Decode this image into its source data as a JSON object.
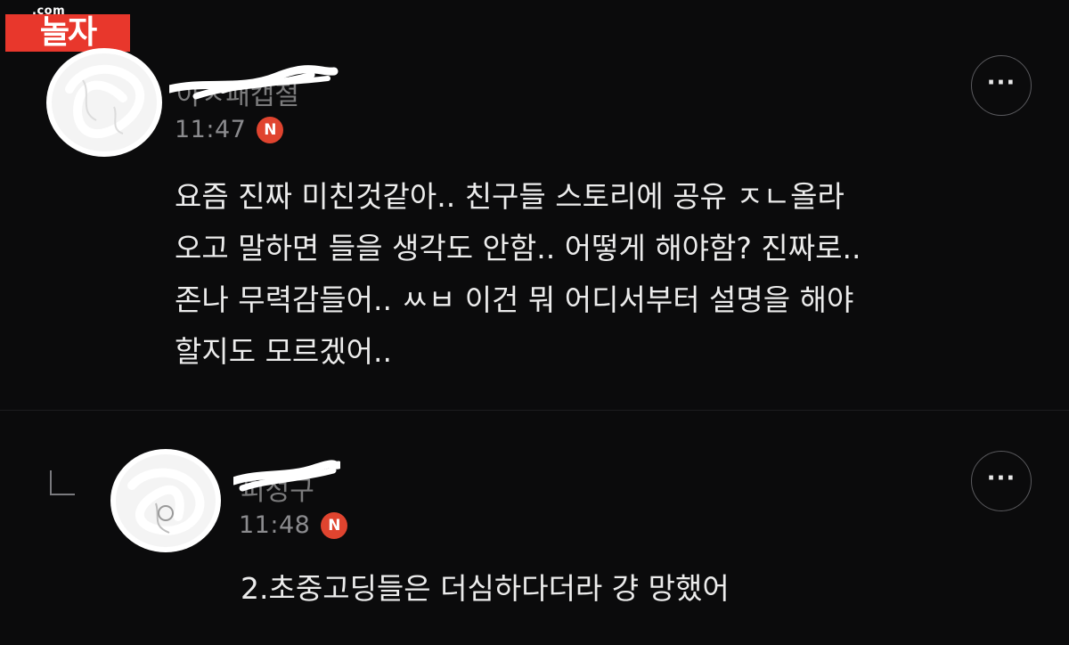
{
  "watermark": {
    "sub": ".com",
    "main": "놀자"
  },
  "comments": [
    {
      "author": "아ㅈ패캡철",
      "time": "11:47",
      "badge": "N",
      "more_label": "···",
      "lines": [
        "요즘 진짜 미친것같아.. 친구들 스토리에 공유 ㅈㄴ올라",
        "오고 말하면 들을 생각도 안함.. 어떻게 해야함? 진짜로..",
        "존나 무력감들어.. ㅆㅂ 이건 뭐 어디서부터 설명을 해야",
        "할지도 모르겠어.."
      ]
    },
    {
      "author": "피성구",
      "time": "11:48",
      "badge": "N",
      "more_label": "···",
      "lines": [
        "2.초중고딩들은 더심하다더라 걍 망했어"
      ]
    }
  ],
  "colors": {
    "background": "#0b0b0c",
    "badge": "#e0442f",
    "watermark": "#e8372c",
    "text": "#ececec",
    "time": "#8b8b8e"
  },
  "icons": {
    "more": "more-horizontal-icon",
    "reply": "reply-corner-icon",
    "new": "new-badge-icon"
  }
}
